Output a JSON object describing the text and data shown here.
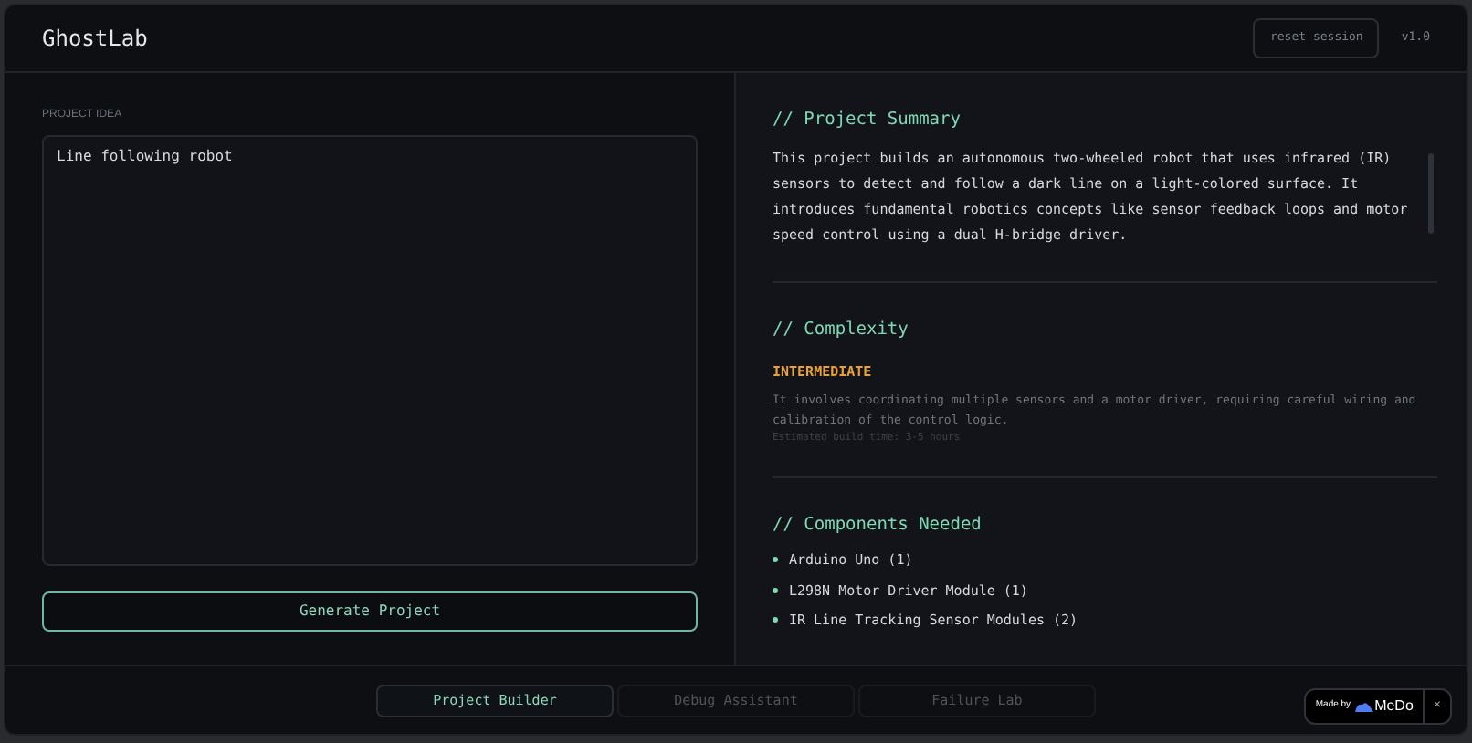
{
  "header": {
    "title": "GhostLab",
    "reset_button": "reset session",
    "version": "v1.0"
  },
  "input": {
    "label": "PROJECT IDEA",
    "value": "Line following robot",
    "button": "Generate Project"
  },
  "summary": {
    "heading": "// Project Summary",
    "text": "This project builds an autonomous two-wheeled robot that uses infrared (IR) sensors to detect and follow a dark line on a light-colored surface. It introduces fundamental robotics concepts like sensor feedback loops and motor speed control using a dual H-bridge driver."
  },
  "complexity": {
    "heading": "// Complexity",
    "level_label": "INTERMEDIATE",
    "text": "It involves coordinating multiple sensors and a motor driver, requiring careful wiring and calibration of the control logic.",
    "build_time": "Estimated build time: 3-5 hours"
  },
  "components": {
    "heading": "// Components Needed",
    "items": [
      "Arduino Uno (1)",
      "L298N Motor Driver Module (1)",
      "IR Line Tracking Sensor Modules (2)"
    ]
  },
  "tabs": [
    {
      "label": "Project Builder",
      "selected": true
    },
    {
      "label": "Debug Assistant",
      "selected": false
    },
    {
      "label": "Failure Lab",
      "selected": false
    }
  ],
  "badge": {
    "made_by": "Made by",
    "brand": "MeDo",
    "close": "×"
  }
}
